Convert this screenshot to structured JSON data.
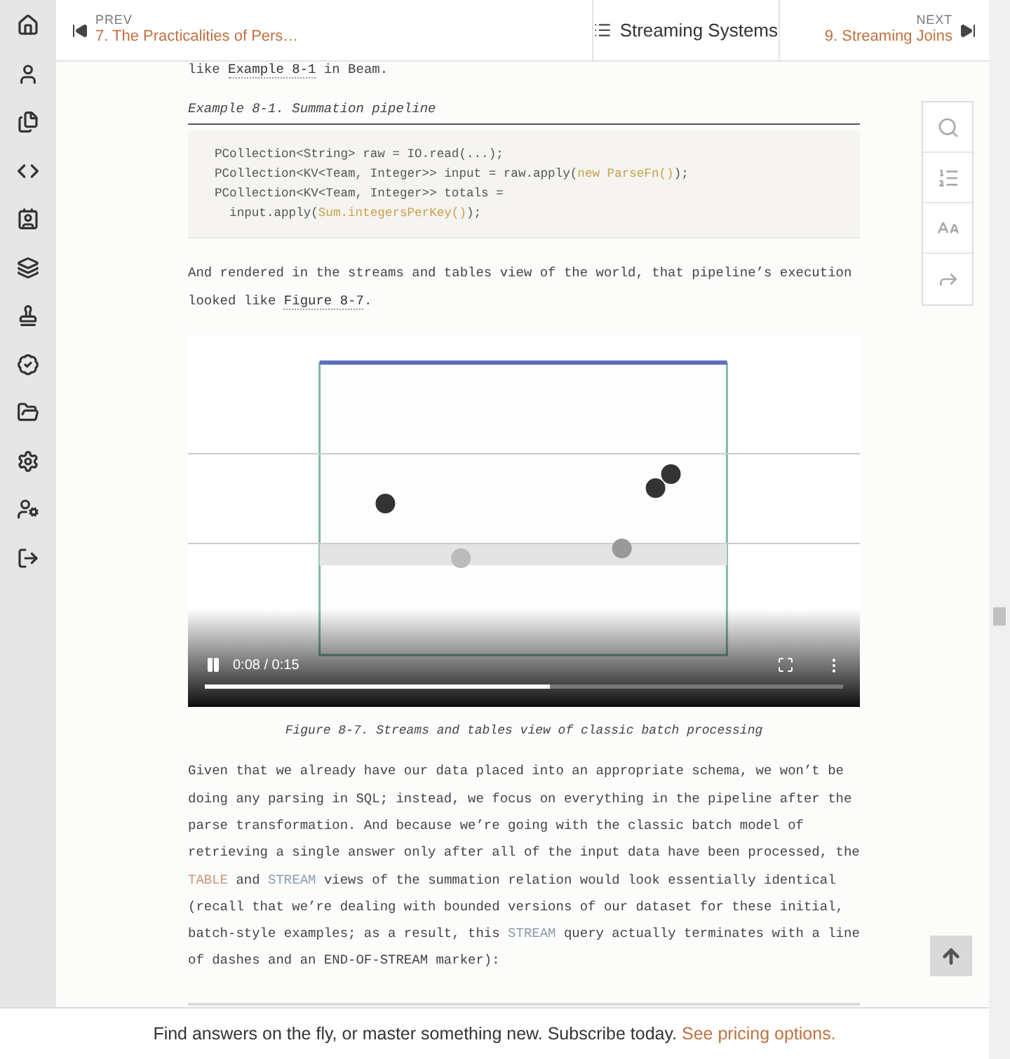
{
  "header": {
    "prev": {
      "label": "PREV",
      "title": "7. The Practicalities of Pers…"
    },
    "book_title": "Streaming Systems",
    "next": {
      "label": "NEXT",
      "title": "9. Streaming Joins"
    }
  },
  "content": {
    "intro": [
      {
        "text": "like ",
        "kind": "text"
      },
      {
        "text": "Example  8-1",
        "kind": "link"
      },
      {
        "text": " in Beam.",
        "kind": "text"
      }
    ],
    "example_caption": "Example 8-1. Summation pipeline",
    "code": [
      [
        {
          "text": "PCollection<String> raw = IO.read(...);",
          "kind": "plain"
        }
      ],
      [
        {
          "text": "PCollection<KV<Team, Integer>> input = raw.apply(",
          "kind": "plain"
        },
        {
          "text": "new ParseFn()",
          "kind": "keyword"
        },
        {
          "text": ");",
          "kind": "plain"
        }
      ],
      [
        {
          "text": "PCollection<KV<Team, Integer>> totals =",
          "kind": "plain"
        }
      ],
      [
        {
          "text": "  input.apply(",
          "kind": "plain"
        },
        {
          "text": "Sum.integersPerKey()",
          "kind": "keyword"
        },
        {
          "text": ");",
          "kind": "plain"
        }
      ]
    ],
    "para1": [
      {
        "text": "And rendered in the streams and tables view of the world, that pipeline’s execution looked like ",
        "kind": "text"
      },
      {
        "text": "Figure  8-7",
        "kind": "link"
      },
      {
        "text": ".",
        "kind": "text"
      }
    ],
    "video": {
      "playing": true,
      "time": "0:08 / 0:15",
      "level": 0.54
    },
    "figure_caption": "Figure 8-7. Streams and tables view of classic batch processing",
    "para2": [
      {
        "text": "Given that we already have our data placed into an appropriate schema, we won’t be doing any parsing in SQL; instead, we focus on everything in the pipeline after the parse transformation. And because we’re going with the classic batch model of retrieving a single answer only after all of the input data have been processed, the ",
        "kind": "text"
      },
      {
        "text": "TABLE",
        "kind": "table"
      },
      {
        "text": " and ",
        "kind": "text"
      },
      {
        "text": "STREAM",
        "kind": "stream"
      },
      {
        "text": " views of the summation relation would look essentially identical (recall that we’re dealing with bounded versions of our dataset for these initial, batch-style examples; as a result, this ",
        "kind": "text"
      },
      {
        "text": "STREAM",
        "kind": "stream"
      },
      {
        "text": " query actually terminates with a line of dashes and an END-OF-STREAM marker):",
        "kind": "text"
      }
    ]
  },
  "banner": {
    "text": "Find answers on the fly, or master something new. Subscribe today.",
    "link": "See pricing options."
  }
}
